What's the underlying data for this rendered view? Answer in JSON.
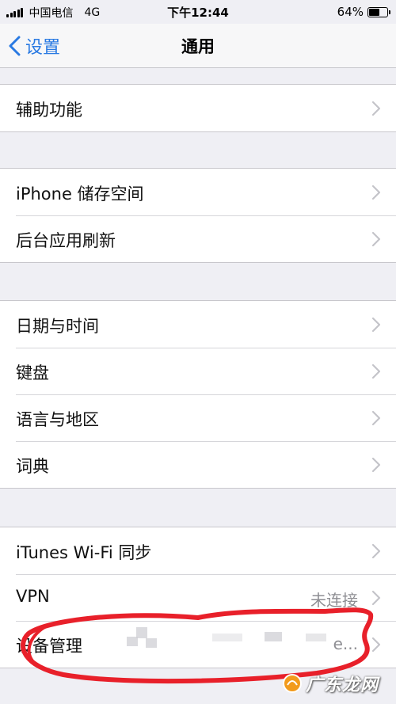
{
  "status_bar": {
    "carrier": "中国电信",
    "network": "4G",
    "time": "下午12:44",
    "battery": "64%",
    "battery_level": 0.64
  },
  "nav": {
    "back_label": "设置",
    "title": "通用"
  },
  "groups": [
    {
      "rows": [
        {
          "label": "辅助功能"
        }
      ]
    },
    {
      "rows": [
        {
          "label": "iPhone 储存空间"
        },
        {
          "label": "后台应用刷新"
        }
      ]
    },
    {
      "rows": [
        {
          "label": "日期与时间"
        },
        {
          "label": "键盘"
        },
        {
          "label": "语言与地区"
        },
        {
          "label": "词典"
        }
      ]
    },
    {
      "rows": [
        {
          "label": "iTunes Wi-Fi 同步"
        },
        {
          "label": "VPN",
          "value": "未连接"
        },
        {
          "label": "设备管理",
          "value": "e..."
        }
      ]
    }
  ],
  "colors": {
    "accent": "#2a7ae2",
    "annotation": "#e8202a",
    "background": "#efeff4"
  },
  "watermark": {
    "text": "广东龙网"
  }
}
